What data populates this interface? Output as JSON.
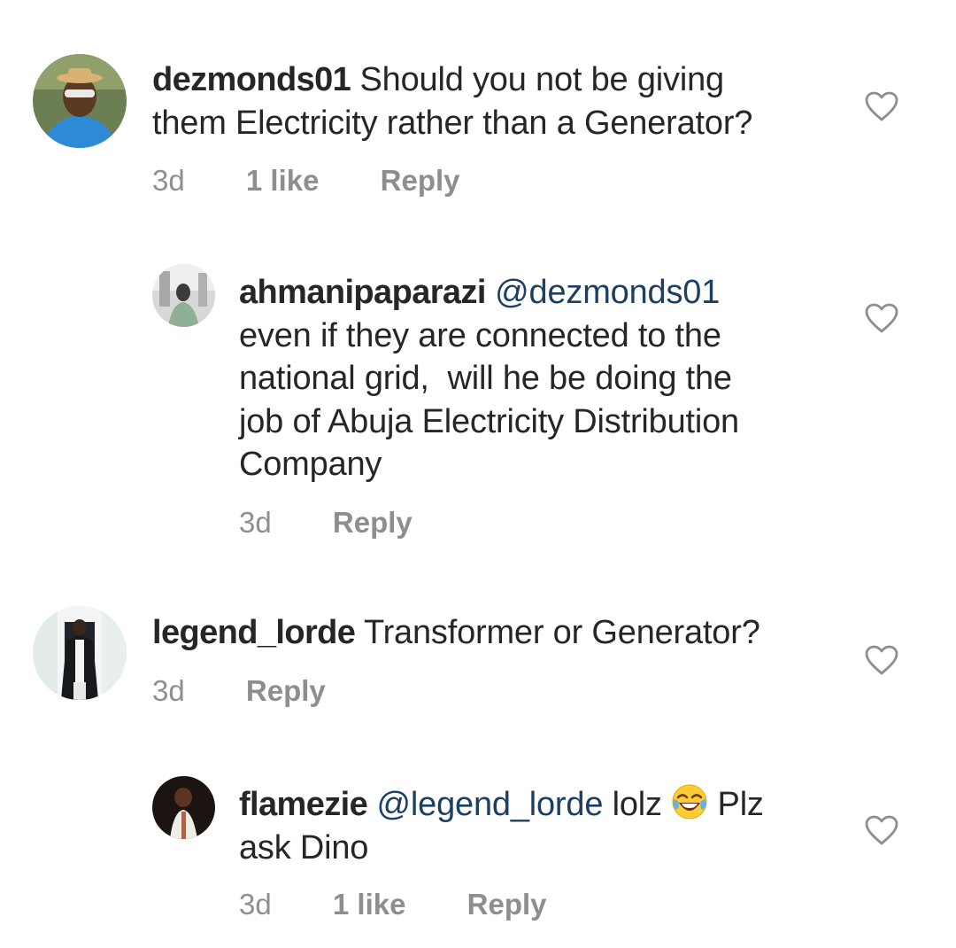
{
  "comments": [
    {
      "username": "dezmonds01",
      "mention": "",
      "line1_after": "Should you not be giving",
      "line2": "them Electricity rather than a Generator?",
      "time": "3d",
      "likes": "1 like",
      "reply": "Reply"
    },
    {
      "username": "ahmanipaparazi",
      "mention": "@dezmonds01",
      "lines": [
        "even if they are connected to the",
        "national grid,  will he be doing the",
        "job of Abuja Electricity Distribution",
        "Company"
      ],
      "time": "3d",
      "reply": "Reply"
    },
    {
      "username": "legend_lorde",
      "text": "Transformer or Generator?",
      "time": "3d",
      "reply": "Reply"
    },
    {
      "username": "flamezie",
      "mention": "@legend_lorde",
      "text_a": "lolz",
      "emoji": "face-with-tears-of-joy",
      "text_b": "Plz",
      "line2": "ask Dino",
      "time": "3d",
      "likes": "1 like",
      "reply": "Reply"
    }
  ],
  "colors": {
    "text": "#262626",
    "meta": "#8e8e8e",
    "mention": "#1c3f63",
    "heart": "#8e8e8e"
  },
  "icons": {
    "like": "heart-outline-icon"
  }
}
